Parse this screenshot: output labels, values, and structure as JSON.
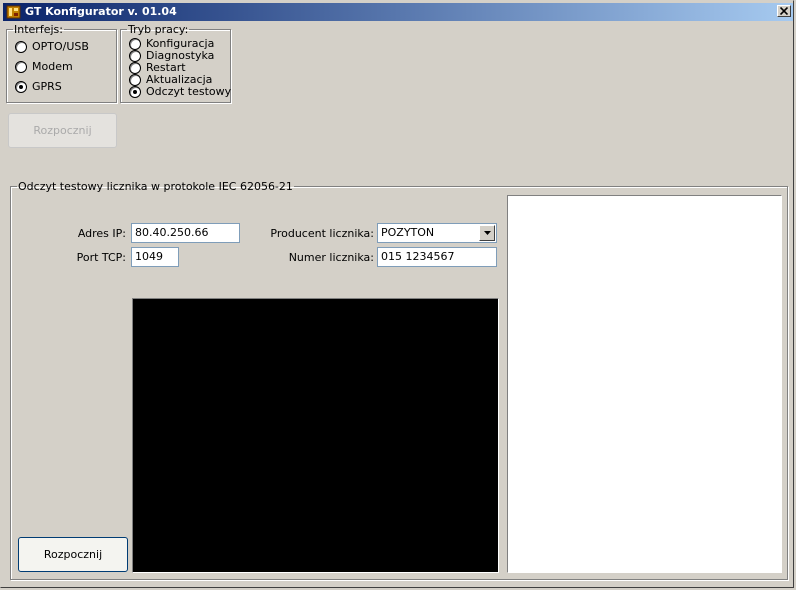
{
  "window": {
    "title": "GT Konfigurator v. 01.04"
  },
  "interface_group": {
    "legend": "Interfejs:",
    "options": [
      {
        "label": "OPTO/USB",
        "checked": false
      },
      {
        "label": "Modem",
        "checked": false
      },
      {
        "label": "GPRS",
        "checked": true
      }
    ]
  },
  "mode_group": {
    "legend": "Tryb pracy:",
    "options": [
      {
        "label": "Konfiguracja",
        "checked": false
      },
      {
        "label": "Diagnostyka",
        "checked": false
      },
      {
        "label": "Restart",
        "checked": false
      },
      {
        "label": "Aktualizacja",
        "checked": false
      },
      {
        "label": "Odczyt testowy",
        "checked": true
      }
    ]
  },
  "top_button": {
    "label": "Rozpocznij",
    "enabled": false
  },
  "test_group": {
    "legend": "Odczyt testowy licznika w protokole IEC 62056-21",
    "ip_label": "Adres IP:",
    "ip_value": "80.40.250.66",
    "port_label": "Port TCP:",
    "port_value": "1049",
    "producer_label": "Producent licznika:",
    "producer_value": "POZYTON",
    "meter_label": "Numer licznika:",
    "meter_value": "015 1234567",
    "start_button": "Rozpocznij"
  },
  "colors": {
    "titlebar_start": "#0a246a",
    "titlebar_end": "#a6caf0",
    "window_bg": "#d4d0c8",
    "terminal_bg": "#000000"
  }
}
